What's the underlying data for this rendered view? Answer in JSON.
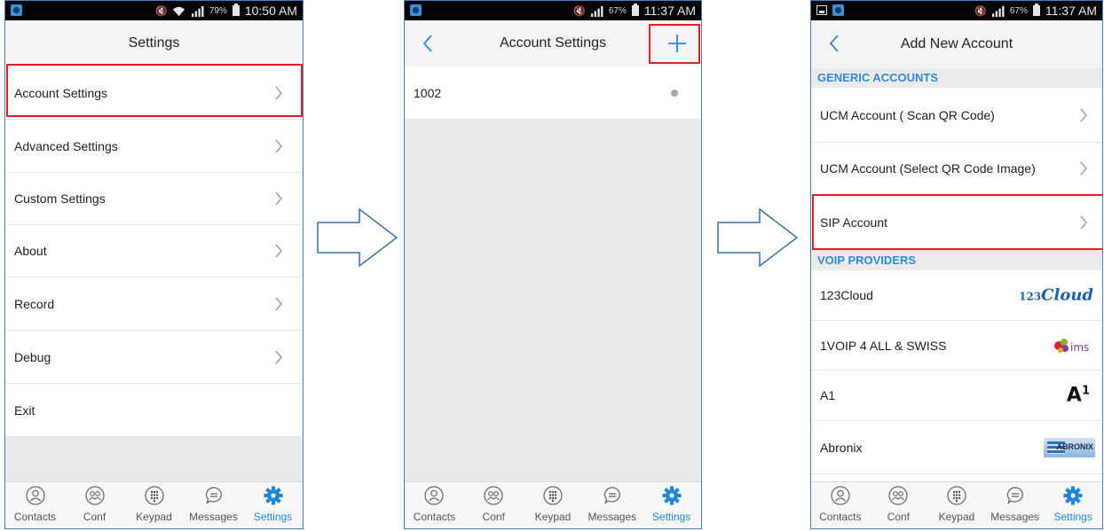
{
  "status": {
    "p1": {
      "battery_pct": "79%",
      "time": "10:50 AM"
    },
    "p2": {
      "battery_pct": "67%",
      "time": "11:37 AM"
    },
    "p3": {
      "battery_pct": "67%",
      "time": "11:37 AM"
    }
  },
  "screen1": {
    "title": "Settings",
    "items": [
      {
        "label": "Account Settings"
      },
      {
        "label": "Advanced Settings"
      },
      {
        "label": "Custom Settings"
      },
      {
        "label": "About"
      },
      {
        "label": "Record"
      },
      {
        "label": "Debug"
      },
      {
        "label": "Exit"
      }
    ]
  },
  "screen2": {
    "title": "Account Settings",
    "account": "1002"
  },
  "screen3": {
    "title": "Add New Account",
    "generic_header": "GENERIC ACCOUNTS",
    "generic_items": [
      {
        "label": "UCM Account ( Scan QR Code)"
      },
      {
        "label": "UCM Account (Select QR Code Image)"
      },
      {
        "label": "SIP Account"
      }
    ],
    "voip_header": "VOIP PROVIDERS",
    "providers": [
      {
        "label": "123Cloud",
        "logo": "123cloud-logo",
        "logo_text": "Cloud",
        "logo_prefix": "123"
      },
      {
        "label": "1VOIP 4 ALL & SWISS",
        "logo": "ims-logo",
        "logo_text": "ims"
      },
      {
        "label": "A1",
        "logo": "a1-logo",
        "logo_text": "A",
        "logo_sup": "1"
      },
      {
        "label": "Abronix",
        "logo": "abronix-logo",
        "logo_text": "ABRONIX"
      }
    ]
  },
  "tabs": [
    {
      "label": "Contacts",
      "icon": "contacts-icon"
    },
    {
      "label": "Conf",
      "icon": "conference-icon"
    },
    {
      "label": "Keypad",
      "icon": "keypad-icon"
    },
    {
      "label": "Messages",
      "icon": "messages-icon"
    },
    {
      "label": "Settings",
      "icon": "settings-gear-icon"
    }
  ],
  "colors": {
    "accent": "#1f86dc",
    "highlight": "#e01f26",
    "section_text": "#2f8ad8"
  }
}
